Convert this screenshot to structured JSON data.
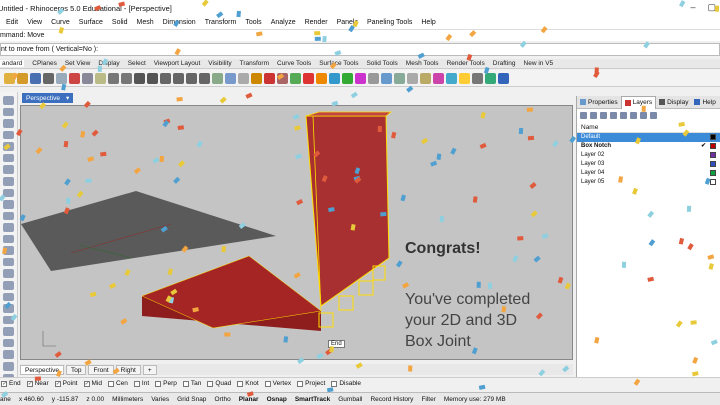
{
  "window": {
    "title": "Untitled - Rhinoceros 5.0 Educational - [Perspective]",
    "controls": [
      "–",
      "▢"
    ]
  },
  "menu": [
    "Edit",
    "View",
    "Curve",
    "Surface",
    "Solid",
    "Mesh",
    "Dimension",
    "Transform",
    "Tools",
    "Analyze",
    "Render",
    "Panels",
    "Paneling Tools",
    "Help"
  ],
  "command": {
    "history": "mmand: Move",
    "prompt": "nt to move from ( Vertical=No ):"
  },
  "toolbar_tabs": [
    "andard",
    "CPlanes",
    "Set View",
    "Display",
    "Select",
    "Viewport Layout",
    "Visibility",
    "Transform",
    "Curve Tools",
    "Surface Tools",
    "Solid Tools",
    "Mesh Tools",
    "Render Tools",
    "Drafting",
    "New in V5"
  ],
  "viewport": {
    "tab": "Perspective",
    "bottom_tabs": [
      "Perspective",
      "Top",
      "Front",
      "Right"
    ],
    "add_tab": "+",
    "snap_tip": "End"
  },
  "overlay": {
    "heading": "Congrats!",
    "message_lines": [
      "You've completed",
      "your 2D and 3D",
      "Box Joint"
    ]
  },
  "panel": {
    "tabs": [
      "Properties",
      "Layers",
      "Display",
      "Help"
    ],
    "column_header": "Name",
    "layers": [
      {
        "name": "Default",
        "selected": true,
        "color": "#000000"
      },
      {
        "name": "Box Notch",
        "bold": true,
        "color": "#c00000",
        "check": "✔"
      },
      {
        "name": "Layer 02",
        "color": "#7030a0"
      },
      {
        "name": "Layer 03",
        "color": "#3050c0"
      },
      {
        "name": "Layer 04",
        "color": "#10a040"
      },
      {
        "name": "Layer 05",
        "color": "#ffffff"
      }
    ]
  },
  "osnap": [
    {
      "label": "End",
      "checked": true
    },
    {
      "label": "Near",
      "checked": true
    },
    {
      "label": "Point",
      "checked": true
    },
    {
      "label": "Mid",
      "checked": true
    },
    {
      "label": "Cen",
      "checked": false
    },
    {
      "label": "Int",
      "checked": false
    },
    {
      "label": "Perp",
      "checked": false
    },
    {
      "label": "Tan",
      "checked": false
    },
    {
      "label": "Quad",
      "checked": false
    },
    {
      "label": "Knot",
      "checked": false
    },
    {
      "label": "Vertex",
      "checked": false
    },
    {
      "label": "Project",
      "checked": false
    },
    {
      "label": "Disable",
      "checked": false
    }
  ],
  "status": {
    "plane": "ane",
    "x": "x 460.60",
    "y": "y -115.87",
    "z": "z 0.00",
    "units": "Millimeters",
    "layer": "Varies",
    "toggles": [
      "Grid Snap",
      "Ortho",
      "Planar",
      "Osnap",
      "SmartTrack",
      "Gumball",
      "Record History",
      "Filter"
    ],
    "bold_toggles": [
      "Planar",
      "Osnap",
      "SmartTrack"
    ],
    "memory": "Memory use: 279 MB"
  }
}
